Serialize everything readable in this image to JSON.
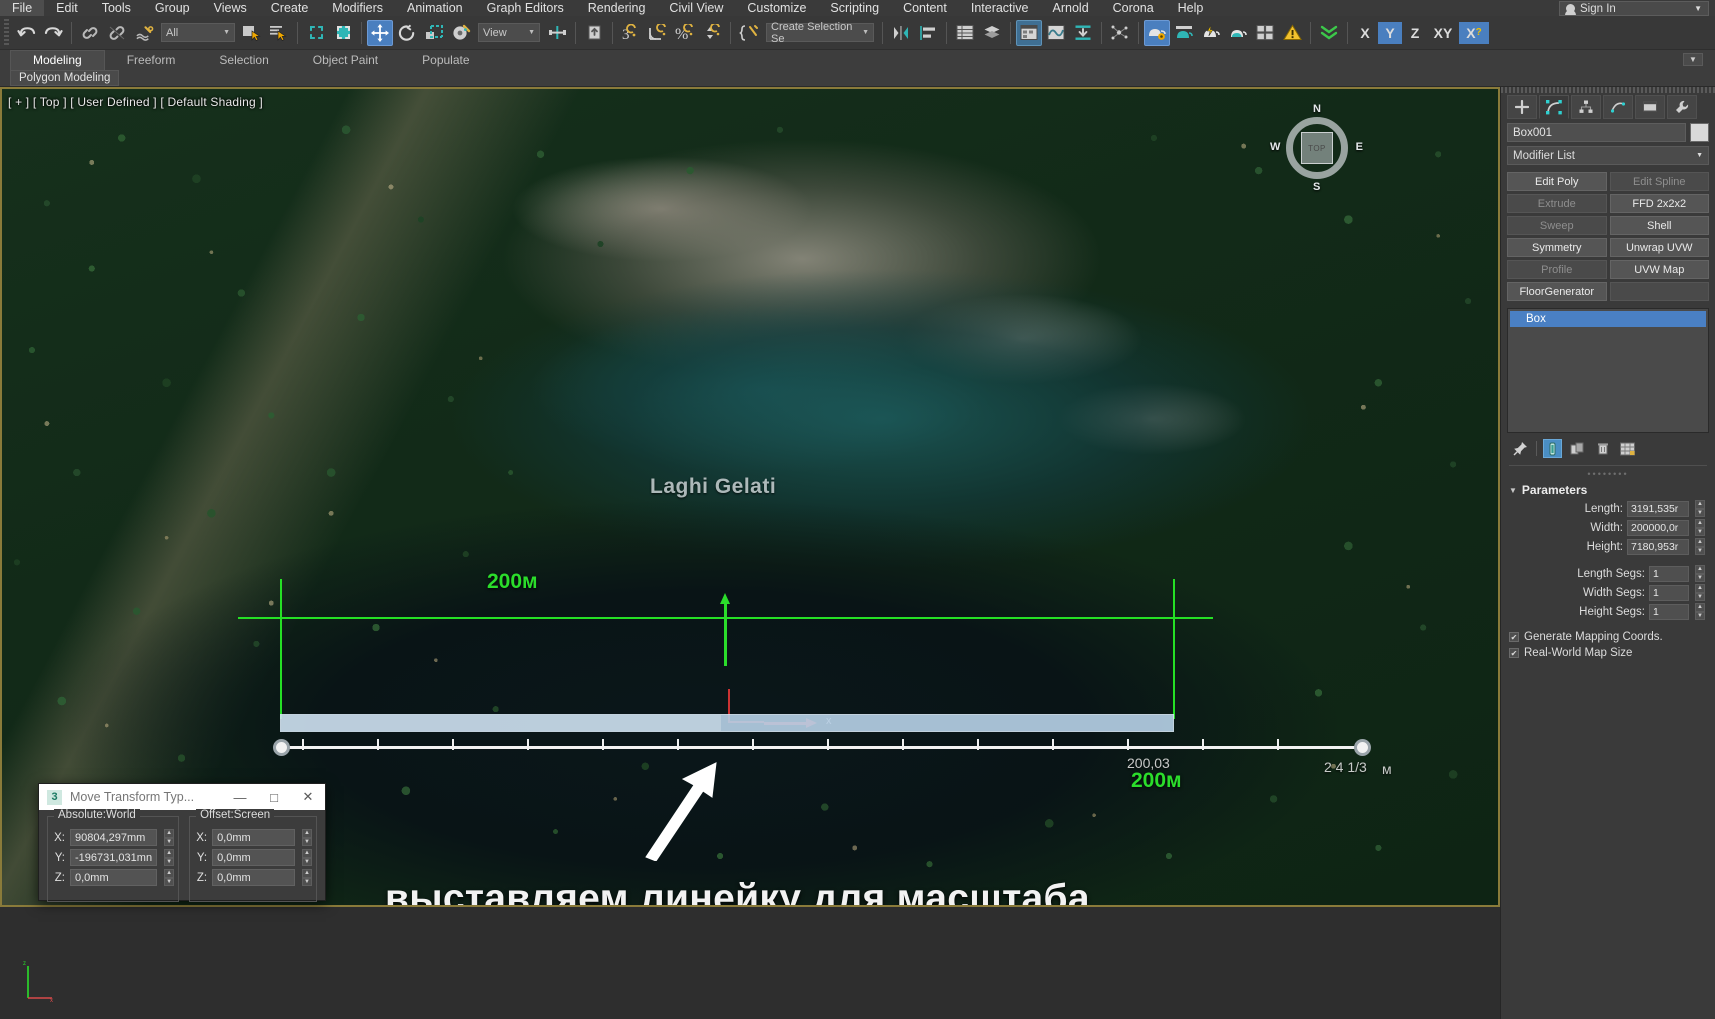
{
  "menu": {
    "items": [
      "File",
      "Edit",
      "Tools",
      "Group",
      "Views",
      "Create",
      "Modifiers",
      "Animation",
      "Graph Editors",
      "Rendering",
      "Civil View",
      "Customize",
      "Scripting",
      "Content",
      "Interactive",
      "Arnold",
      "Corona",
      "Help"
    ],
    "signin_label": "Sign In"
  },
  "toolbar": {
    "undo": "undo-arrow",
    "redo": "redo-arrow",
    "select_filter": "All",
    "reference_coord": "View",
    "selection_set": "Create Selection Se",
    "axis_x": "X",
    "axis_y": "Y",
    "axis_z": "Z",
    "axis_xy": "XY",
    "axis_xq": "X"
  },
  "ribbon": {
    "tabs": [
      "Modeling",
      "Freeform",
      "Selection",
      "Object Paint",
      "Populate"
    ],
    "active_tab": "Modeling",
    "subtab": "Polygon Modeling"
  },
  "viewport": {
    "label": "[ + ] [ Top ] [ User Defined ] [ Default Shading ]",
    "place_name": "Laghi Gelati",
    "viewcube": {
      "top": "TOP",
      "n": "N",
      "s": "S",
      "e": "E",
      "w": "W"
    },
    "annotation_scale_top": "200м",
    "annotation_scale_bottom": "200м",
    "ruler_value_mid": "200,03",
    "ruler_value_end": "2 4 1/3",
    "ruler_unit_end": "м",
    "gizmo_axis_label": "x",
    "caption_ru": "выставляем линейку для масштаба"
  },
  "move_dialog": {
    "title": "Move Transform Typ...",
    "icon_label": "3",
    "minimize": "—",
    "maximize": "□",
    "close": "✕",
    "absolute_legend": "Absolute:World",
    "offset_legend": "Offset:Screen",
    "absolute": [
      {
        "label": "X:",
        "value": "90804,297mm"
      },
      {
        "label": "Y:",
        "value": "-196731,031mn"
      },
      {
        "label": "Z:",
        "value": "0,0mm"
      }
    ],
    "offset": [
      {
        "label": "X:",
        "value": "0,0mm"
      },
      {
        "label": "Y:",
        "value": "0,0mm"
      },
      {
        "label": "Z:",
        "value": "0,0mm"
      }
    ]
  },
  "command_panel": {
    "tabs": [
      "create-tab",
      "modify-tab",
      "hierarchy-tab",
      "motion-tab",
      "display-tab",
      "utilities-tab"
    ],
    "object_name": "Box001",
    "modifier_list": "Modifier List",
    "modifier_buttons": [
      {
        "label": "Edit Poly",
        "enabled": true
      },
      {
        "label": "Edit Spline",
        "enabled": false
      },
      {
        "label": "Extrude",
        "enabled": false
      },
      {
        "label": "FFD 2x2x2",
        "enabled": true
      },
      {
        "label": "Sweep",
        "enabled": false
      },
      {
        "label": "Shell",
        "enabled": true
      },
      {
        "label": "Symmetry",
        "enabled": true
      },
      {
        "label": "Unwrap UVW",
        "enabled": true
      },
      {
        "label": "Profile",
        "enabled": false
      },
      {
        "label": "UVW Map",
        "enabled": true
      }
    ],
    "floorgenerator_label": "FloorGenerator",
    "stack": [
      {
        "label": "Box",
        "selected": true
      }
    ],
    "stack_icons": [
      "pin-stack-icon",
      "show-end-result-icon",
      "make-unique-icon",
      "remove-modifier-icon",
      "configure-sets-icon"
    ],
    "rollout_title": "Parameters",
    "parameters": [
      {
        "label": "Length:",
        "value": "3191,535r"
      },
      {
        "label": "Width:",
        "value": "200000,0r"
      },
      {
        "label": "Height:",
        "value": "7180,953r"
      }
    ],
    "segments": [
      {
        "label": "Length Segs:",
        "value": "1"
      },
      {
        "label": "Width Segs:",
        "value": "1"
      },
      {
        "label": "Height Segs:",
        "value": "1"
      }
    ],
    "checkboxes": [
      {
        "label": "Generate Mapping Coords.",
        "checked": true
      },
      {
        "label": "Real-World Map Size",
        "checked": true
      }
    ]
  },
  "colors": {
    "accent_blue": "#4a80c4",
    "annotation_green": "#2bdd2b",
    "viewport_border": "#8a7b3a",
    "panel_bg": "#3a3a3a"
  }
}
